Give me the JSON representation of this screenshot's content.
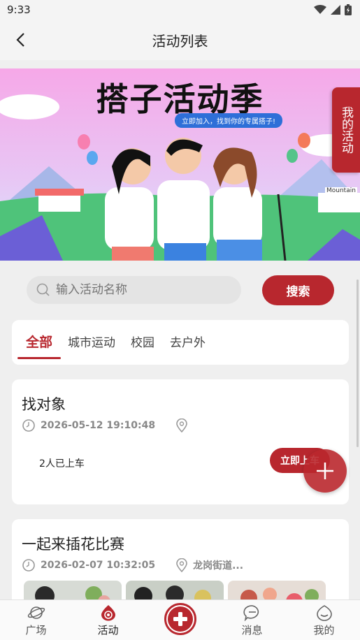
{
  "status_bar": {
    "time": "9:33"
  },
  "header": {
    "title": "活动列表"
  },
  "banner": {
    "title": "搭子活动季",
    "subtitle": "立即加入，找到你的专属搭子!",
    "sign_text": "Mountain"
  },
  "float_tab": {
    "label": "我的活动"
  },
  "search": {
    "placeholder": "输入活动名称",
    "button_label": "搜索"
  },
  "tabs": [
    {
      "label": "全部",
      "active": true
    },
    {
      "label": "城市运动",
      "active": false
    },
    {
      "label": "校园",
      "active": false
    },
    {
      "label": "去户外",
      "active": false
    }
  ],
  "activities": [
    {
      "title": "找对象",
      "datetime": "2026-05-12 19:10:48",
      "location": "",
      "joined": "2人已上车",
      "button_label": "立即上车"
    },
    {
      "title": "一起来插花比赛",
      "datetime": "2026-02-07 10:32:05",
      "location": "龙岗街道..."
    }
  ],
  "bottom_nav": [
    {
      "label": "广场",
      "icon": "planet-icon"
    },
    {
      "label": "活动",
      "icon": "activity-icon",
      "active": true
    },
    {
      "label": "",
      "icon": "plus-center-icon"
    },
    {
      "label": "消息",
      "icon": "message-icon"
    },
    {
      "label": "我的",
      "icon": "profile-icon"
    }
  ],
  "colors": {
    "accent": "#b8272e",
    "background": "#efefef"
  }
}
